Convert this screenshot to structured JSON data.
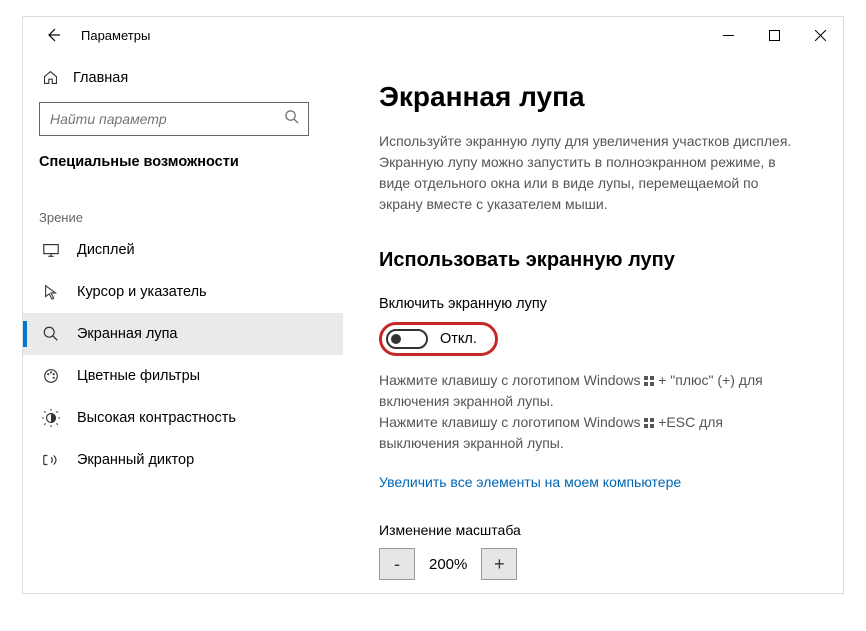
{
  "titlebar": {
    "title": "Параметры"
  },
  "sidebar": {
    "home": "Главная",
    "search_placeholder": "Найти параметр",
    "category": "Специальные возможности",
    "section": "Зрение",
    "items": [
      {
        "label": "Дисплей"
      },
      {
        "label": "Курсор и указатель"
      },
      {
        "label": "Экранная лупа"
      },
      {
        "label": "Цветные фильтры"
      },
      {
        "label": "Высокая контрастность"
      },
      {
        "label": "Экранный диктор"
      }
    ]
  },
  "content": {
    "heading": "Экранная лупа",
    "description": "Используйте экранную лупу для увеличения участков дисплея. Экранную лупу можно запустить в полноэкранном режиме, в виде отдельного окна или в виде лупы, перемещаемой по экрану вместе с указателем мыши.",
    "section_heading": "Использовать экранную лупу",
    "toggle_label": "Включить экранную лупу",
    "toggle_state": "Откл.",
    "hint1a": "Нажмите клавишу с логотипом Windows",
    "hint1b": "+ \"плюс\" (+) для включения экранной лупы.",
    "hint2a": "Нажмите клавишу с логотипом Windows",
    "hint2b": "+ESC для выключения экранной лупы.",
    "link": "Увеличить все элементы на моем компьютере",
    "zoom_heading": "Изменение масштаба",
    "zoom_value": "200%",
    "zoom_minus": "-",
    "zoom_plus": "+"
  }
}
